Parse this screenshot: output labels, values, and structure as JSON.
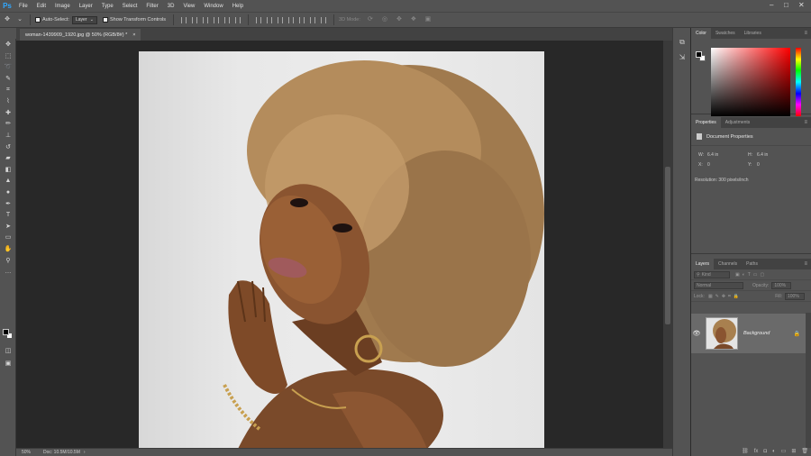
{
  "app": {
    "logo": "Ps"
  },
  "menu": [
    "File",
    "Edit",
    "Image",
    "Layer",
    "Type",
    "Select",
    "Filter",
    "3D",
    "View",
    "Window",
    "Help"
  ],
  "window_controls": [
    "–",
    "□",
    "✕"
  ],
  "options": {
    "auto_select_label": "Auto-Select:",
    "auto_select_value": "Layer",
    "transform_label": "Show Transform Controls",
    "mode_3d_label": "3D Mode:"
  },
  "document": {
    "tab_title": "woman-1439909_1920.jpg @ 50% (RGB/8#) *",
    "close": "×",
    "zoom": "50%",
    "doc_info": "Doc: 10.5M/10.5M"
  },
  "panels": {
    "color_tabs": [
      "Color",
      "Swatches",
      "Libraries"
    ],
    "props_tabs": [
      "Properties",
      "Adjustments"
    ],
    "props_title": "Document Properties",
    "width_label": "W:",
    "width_value": "6.4 in",
    "height_label": "H:",
    "height_value": "6.4 in",
    "x_label": "X:",
    "x_value": "0",
    "y_label": "Y:",
    "y_value": "0",
    "resolution": "Resolution: 300 pixels/inch",
    "layers_tabs": [
      "Layers",
      "Channels",
      "Paths"
    ],
    "kind_placeholder": "Kind",
    "blend_mode": "Normal",
    "opacity_label": "Opacity:",
    "opacity_value": "100%",
    "lock_label": "Lock:",
    "fill_label": "Fill:",
    "fill_value": "100%",
    "layer_name": "Background"
  },
  "colors": {
    "foreground": "#000000",
    "background": "#ffffff",
    "ui_panel": "#535353",
    "canvas_bg": "#282828"
  },
  "tool_icons": [
    "move-icon",
    "marquee-icon",
    "lasso-icon",
    "quick-select-icon",
    "crop-icon",
    "eyedropper-icon",
    "healing-icon",
    "brush-icon",
    "clone-stamp-icon",
    "history-brush-icon",
    "eraser-icon",
    "gradient-icon",
    "blur-icon",
    "dodge-icon",
    "pen-icon",
    "type-icon",
    "path-select-icon",
    "rectangle-icon",
    "hand-icon",
    "zoom-icon",
    "more-icon"
  ]
}
